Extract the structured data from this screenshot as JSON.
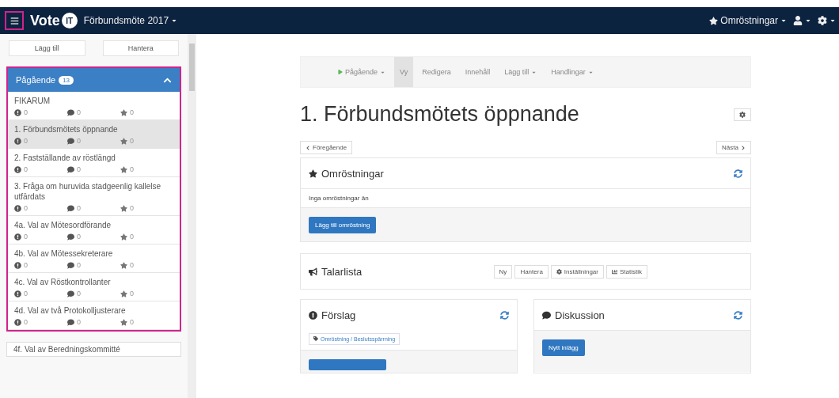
{
  "navbar": {
    "brand": "Vote",
    "brand_mark": "IT",
    "meeting": "Förbundsmöte 2017",
    "polls": "Omröstningar"
  },
  "sidebar": {
    "buttons": [
      "Lägg till",
      "Hantera"
    ],
    "panel": {
      "title": "Pågående",
      "count": "13",
      "expanded": true,
      "items": [
        {
          "title": "FIKARUM",
          "proposals": "0",
          "discussion": "0",
          "polls": "0",
          "selected": false
        },
        {
          "title": "1. Förbundsmötets öppnande",
          "proposals": "0",
          "discussion": "0",
          "polls": "0",
          "selected": true
        },
        {
          "title": "2. Fastställande av röstlängd",
          "proposals": "0",
          "discussion": "0",
          "polls": "0",
          "selected": false
        },
        {
          "title": "3. Fråga om huruvida stadgeenlig kallelse utfärdats",
          "proposals": "0",
          "discussion": "0",
          "polls": "0",
          "selected": false
        },
        {
          "title": "4a. Val av Mötesordförande",
          "proposals": "0",
          "discussion": "0",
          "polls": "0",
          "selected": false
        },
        {
          "title": "4b. Val av Mötessekreterare",
          "proposals": "0",
          "discussion": "0",
          "polls": "0",
          "selected": false
        },
        {
          "title": "4c. Val av Röstkontrollanter",
          "proposals": "0",
          "discussion": "0",
          "polls": "0",
          "selected": false
        },
        {
          "title": "4d. Val av två Protokolljusterare",
          "proposals": "0",
          "discussion": "0",
          "polls": "0",
          "selected": false
        }
      ]
    },
    "next_item": "4f. Val av Beredningskommitté"
  },
  "toolbar": [
    {
      "label": "Pågående",
      "kind": "state",
      "selected": false
    },
    {
      "label": "Vy",
      "kind": "plain",
      "selected": true
    },
    {
      "label": "Redigera",
      "kind": "plain",
      "selected": false
    },
    {
      "label": "Innehåll",
      "kind": "plain",
      "selected": false
    },
    {
      "label": "Lägg till",
      "kind": "dropdown",
      "selected": false
    },
    {
      "label": "Handlingar",
      "kind": "dropdown",
      "selected": false
    }
  ],
  "title": "1. Förbundsmötets öppnande",
  "pager": {
    "previous": "Föregående",
    "next": "Nästa"
  },
  "polls": {
    "title": "Omröstningar",
    "empty": "Inga omröstningar än",
    "add": "Lägg till omröstning"
  },
  "speakers": {
    "title": "Talarlista",
    "buttons": [
      "Ny",
      "Hantera",
      "Inställningar",
      "Statistik"
    ]
  },
  "proposals": {
    "title": "Förslag",
    "tag": "Omröstning / Beslutsspärrning"
  },
  "discussion": {
    "title": "Diskussion",
    "add": "Nytt inlägg"
  }
}
